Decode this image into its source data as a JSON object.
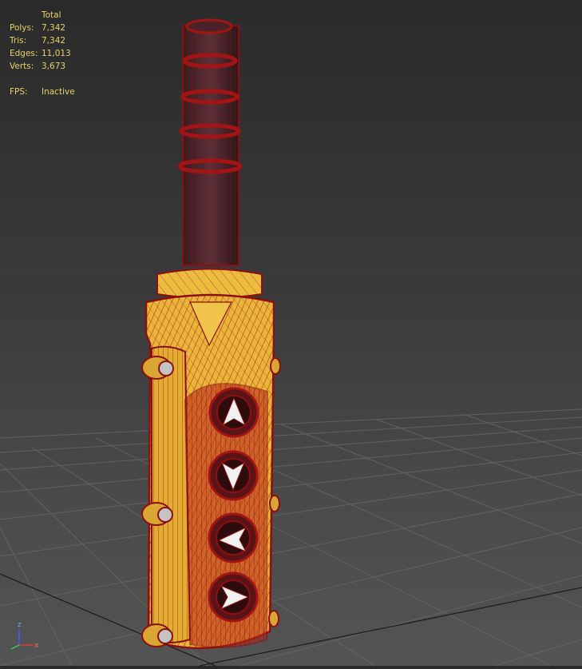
{
  "stats": {
    "header": "Total",
    "rows": [
      {
        "label": "Polys:",
        "value": "7,342"
      },
      {
        "label": "Tris:",
        "value": "7,342"
      },
      {
        "label": "Edges:",
        "value": "11,013"
      },
      {
        "label": "Verts:",
        "value": "3,673"
      }
    ],
    "fps_label": "FPS:",
    "fps_value": "Inactive"
  },
  "gizmo": {
    "z": "z",
    "x": "x"
  },
  "colors": {
    "background": "#3a3a3a",
    "stats_text": "#e6d26a",
    "wire": "#8e0f0f",
    "body": "#e9b53a",
    "grid": "#6a6a6a"
  },
  "model": {
    "type": "pendant-control-wireframe",
    "buttons": [
      "arrow-up-icon",
      "arrow-down-icon",
      "arrow-left-icon",
      "arrow-right-icon"
    ]
  }
}
